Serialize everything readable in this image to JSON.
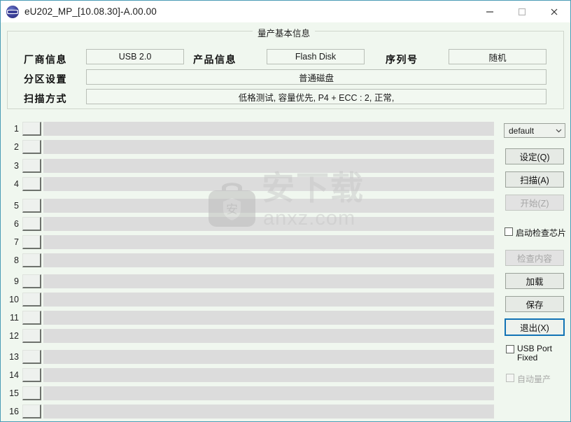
{
  "window": {
    "title": "eU202_MP_[10.08.30]-A.00.00",
    "icon": "app-logo-icon",
    "minimize_label": "—",
    "maximize_label": "□",
    "close_label": "✕"
  },
  "groupbox": {
    "title": "量产基本信息"
  },
  "form": {
    "vendor_label": "厂商信息",
    "vendor_value": "USB 2.0",
    "product_label": "产品信息",
    "product_value": "Flash Disk",
    "serial_label": "序列号",
    "serial_value": "随机",
    "partition_label": "分区设置",
    "partition_value": "普通磁盘",
    "scan_label": "扫描方式",
    "scan_value": "低格测试, 容量优先, P4 + ECC : 2, 正常,"
  },
  "rows": [
    {
      "num": "1"
    },
    {
      "num": "2"
    },
    {
      "num": "3"
    },
    {
      "num": "4"
    },
    {
      "num": "5"
    },
    {
      "num": "6"
    },
    {
      "num": "7"
    },
    {
      "num": "8"
    },
    {
      "num": "9"
    },
    {
      "num": "10"
    },
    {
      "num": "11"
    },
    {
      "num": "12"
    },
    {
      "num": "13"
    },
    {
      "num": "14"
    },
    {
      "num": "15"
    },
    {
      "num": "16"
    }
  ],
  "panel": {
    "profile_value": "default",
    "profile_arrow": "⌄",
    "set_label": "设定(Q)",
    "scan_label": "扫描(A)",
    "start_label": "开始(Z)",
    "check_content_label": "检查内容",
    "load_label": "加载",
    "save_label": "保存",
    "exit_label": "退出(X)",
    "boot_check_chip_label": "启动检查芯片",
    "usb_port_fixed_label": "USB Port Fixed",
    "auto_mp_label": "自动量产"
  },
  "watermark": {
    "text": "安下载",
    "sub": "anxz.com",
    "badge": "安"
  },
  "colors": {
    "window_bg": "#f0f7ef",
    "border": "#4a9cb5",
    "bar": "#dcdcdc",
    "focus": "#1173b5"
  }
}
